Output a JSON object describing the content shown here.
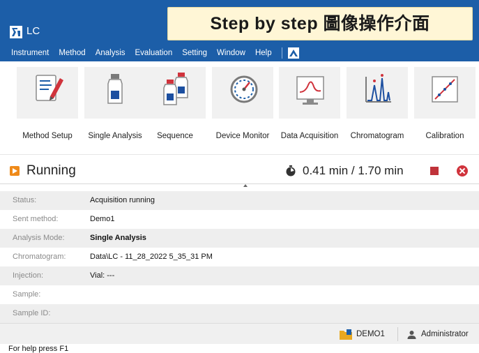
{
  "app": {
    "title": "LC"
  },
  "banner": {
    "text": "Step by step  圖像操作介面"
  },
  "menu": {
    "items": [
      "Instrument",
      "Method",
      "Analysis",
      "Evaluation",
      "Setting",
      "Window",
      "Help"
    ]
  },
  "toolbar": {
    "tools": [
      {
        "label": "Method Setup",
        "icon": "method-setup-icon"
      },
      {
        "label": "Single Analysis",
        "icon": "single-analysis-icon"
      },
      {
        "label": "Sequence",
        "icon": "sequence-icon"
      },
      {
        "label": "Device Monitor",
        "icon": "device-monitor-icon"
      },
      {
        "label": "Data Acquisition",
        "icon": "data-acquisition-icon"
      },
      {
        "label": "Chromatogram",
        "icon": "chromatogram-icon"
      },
      {
        "label": "Calibration",
        "icon": "calibration-icon"
      }
    ]
  },
  "run": {
    "state": "Running",
    "elapsed": "0.41 min / 1.70 min"
  },
  "details": [
    {
      "label": "Status:",
      "value": "Acquisition running",
      "bold": false
    },
    {
      "label": "Sent method:",
      "value": "Demo1",
      "bold": false
    },
    {
      "label": "Analysis Mode:",
      "value": "Single Analysis",
      "bold": true
    },
    {
      "label": "Chromatogram:",
      "value": "Data\\LC - 11_28_2022 5_35_31 PM",
      "bold": false
    },
    {
      "label": "Injection:",
      "value": "Vial: ---",
      "bold": false
    },
    {
      "label": "Sample:",
      "value": "",
      "bold": false
    },
    {
      "label": "Sample ID:",
      "value": "",
      "bold": false
    }
  ],
  "statusbar": {
    "database": "DEMO1",
    "user": "Administrator",
    "help": "For help press F1"
  },
  "colors": {
    "titlebar": "#1c5ea8",
    "running": "#ef8a1a",
    "stop": "#c0333a",
    "banner": "#fff6d6"
  }
}
